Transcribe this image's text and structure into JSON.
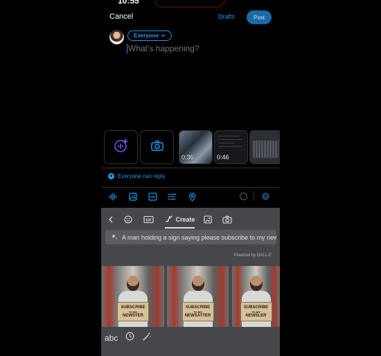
{
  "status_bar": {
    "time": "10:55"
  },
  "header": {
    "cancel_label": "Cancel",
    "drafts_label": "Drafts",
    "post_label": "Post"
  },
  "composer": {
    "audience_label": "Everyone",
    "placeholder": "What’s happening?"
  },
  "media_strip": {
    "items": [
      {
        "kind": "voice-post-button",
        "icon": "voice-plus-icon"
      },
      {
        "kind": "camera-button",
        "icon": "camera-icon"
      },
      {
        "kind": "video-thumbnail",
        "duration": "0:36"
      },
      {
        "kind": "video-thumbnail",
        "duration": "0:46"
      },
      {
        "kind": "image-thumbnail"
      }
    ]
  },
  "reply_setting": {
    "label": "Everyone can reply",
    "icon": "globe-icon"
  },
  "toolbar": {
    "icons": [
      "audio-waveform-icon",
      "image-icon",
      "gif-icon",
      "poll-icon",
      "location-icon"
    ],
    "right_icons": [
      "progress-ring-icon",
      "add-post-icon"
    ]
  },
  "keyboard": {
    "tabs": [
      {
        "icon": "back-chevron-icon"
      },
      {
        "icon": "emoji-icon"
      },
      {
        "icon": "gif-icon",
        "label": "GIF"
      },
      {
        "icon": "create-brush-icon",
        "label": "Create",
        "active": true
      },
      {
        "icon": "sticker-icon"
      },
      {
        "icon": "camera-icon"
      }
    ],
    "prompt": "A man holding a sign saying please subscribe to my new...",
    "powered_by": "Powered by DALL-E",
    "results": [
      {
        "sign_line1": "SUBSCRIBE",
        "sign_line2": "TO MY",
        "sign_line3": "NEWSTER"
      },
      {
        "sign_line1": "SUBSCRIBE",
        "sign_line2": "TO MY",
        "sign_line3": "NEWSATTER"
      },
      {
        "sign_line1": "SUBSCRIBE",
        "sign_line2": "TO MY",
        "sign_line3": "NEWSLER"
      }
    ],
    "footer": {
      "abc_label": "abc",
      "icons": [
        "recent-clock-icon",
        "magic-wand-icon"
      ]
    }
  },
  "colors": {
    "accent": "#1d9bf0",
    "post_button": "#1a6aa8",
    "keyboard_bg": "#46474a",
    "background": "#000000"
  }
}
